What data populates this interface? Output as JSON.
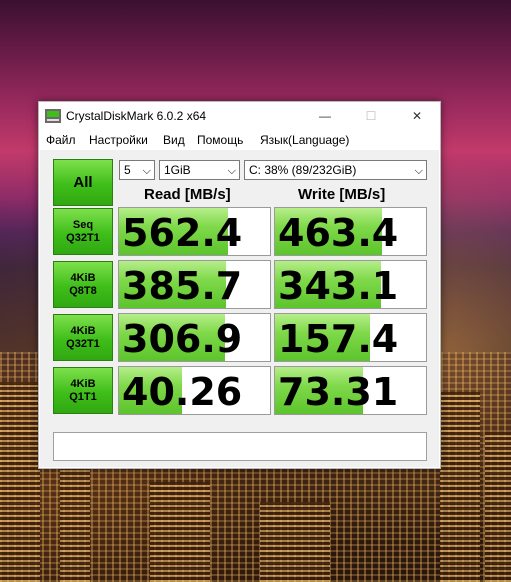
{
  "window": {
    "title": "CrystalDiskMark 6.0.2 x64",
    "minimize": "—",
    "maximize": "☐",
    "close": "✕"
  },
  "menu": [
    "Файл",
    "Настройки",
    "Вид",
    "Помощь",
    "Язык(Language)"
  ],
  "toolbar": {
    "all_label": "All",
    "count": "5",
    "size": "1GiB",
    "drive": "C: 38% (89/232GiB)"
  },
  "headers": {
    "read": "Read [MB/s]",
    "write": "Write [MB/s]"
  },
  "rows": [
    {
      "line1": "Seq",
      "line2": "Q32T1",
      "read": "562.4",
      "write": "463.4",
      "read_fill": 0.72,
      "write_fill": 0.71
    },
    {
      "line1": "4KiB",
      "line2": "Q8T8",
      "read": "385.7",
      "write": "343.1",
      "read_fill": 0.71,
      "write_fill": 0.7
    },
    {
      "line1": "4KiB",
      "line2": "Q32T1",
      "read": "306.9",
      "write": "157.4",
      "read_fill": 0.7,
      "write_fill": 0.63
    },
    {
      "line1": "4KiB",
      "line2": "Q1T1",
      "read": "40.26",
      "write": "73.31",
      "read_fill": 0.42,
      "write_fill": 0.58
    }
  ],
  "comment": "",
  "colors": {
    "accent_green": "#3fbe1a",
    "bar_green": "#7fd94a"
  }
}
